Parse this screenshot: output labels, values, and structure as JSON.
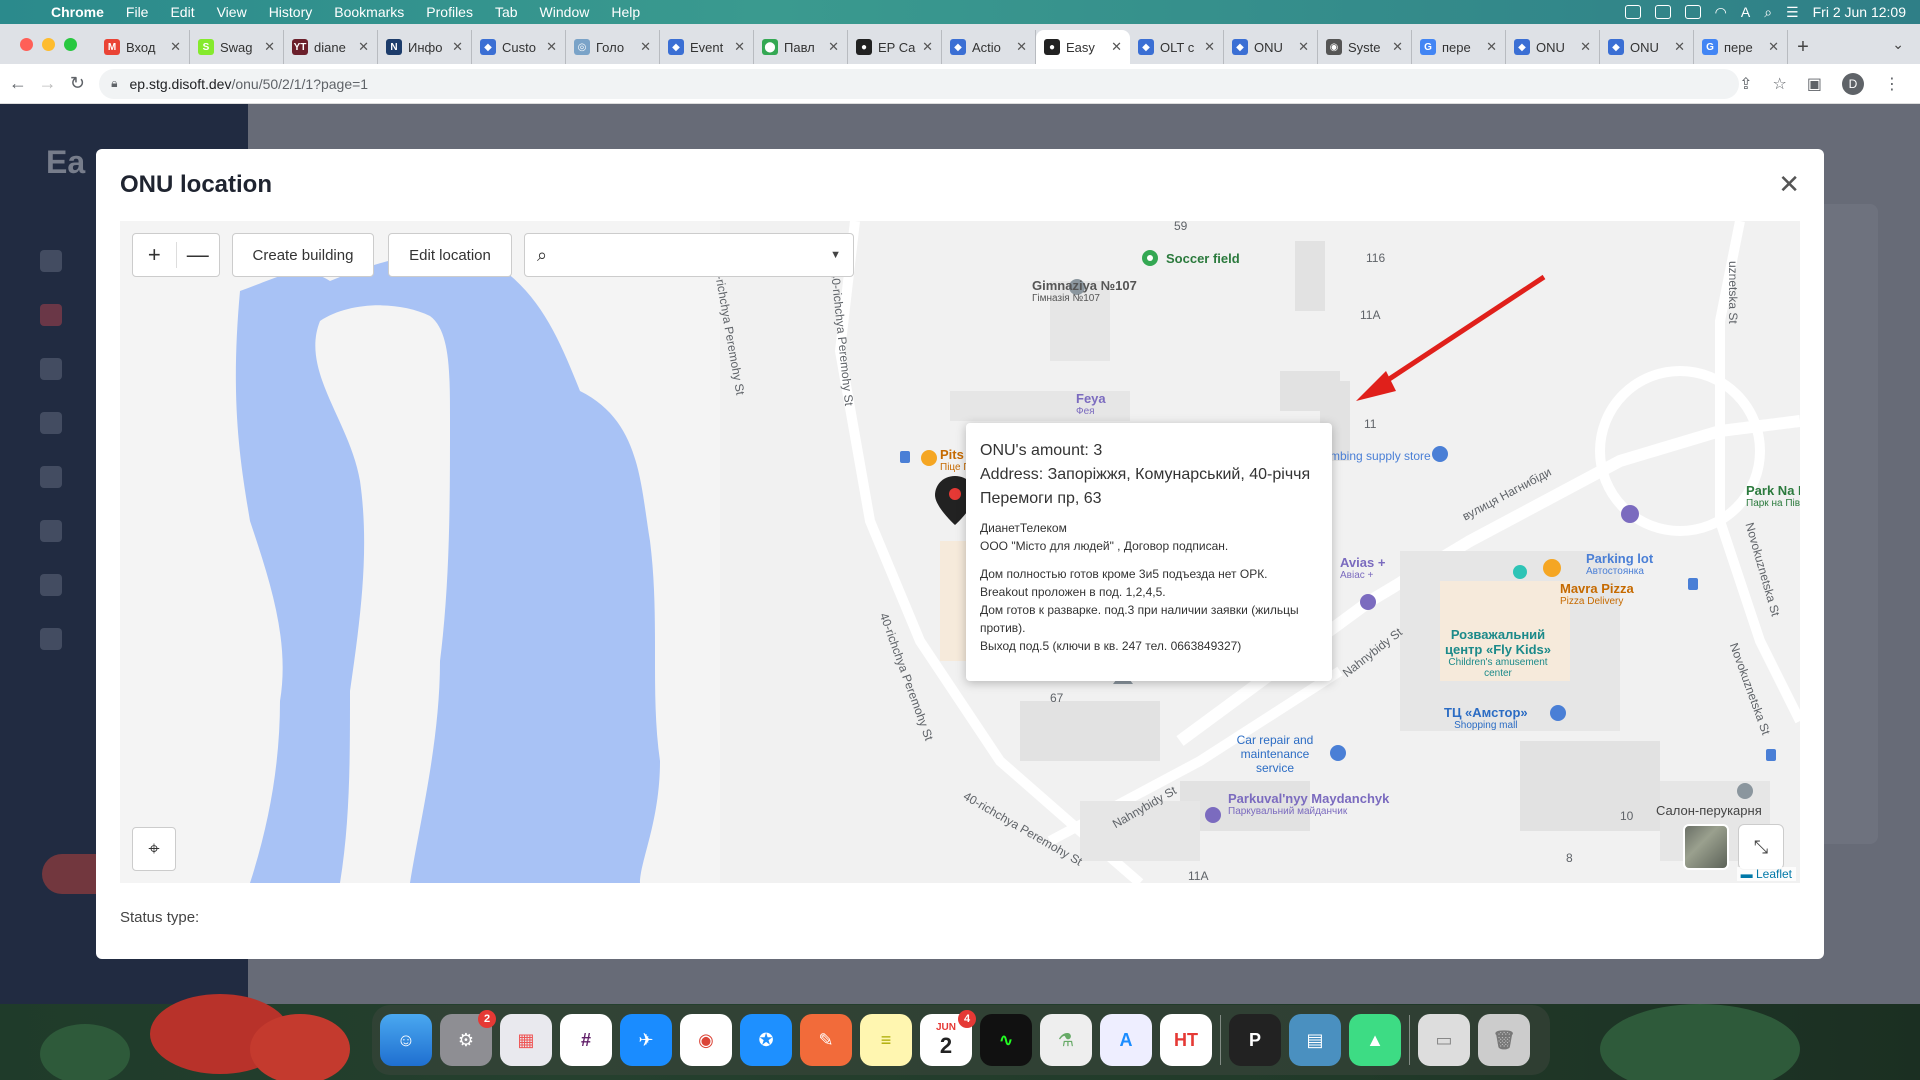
{
  "menubar": {
    "app": "Chrome",
    "items": [
      "File",
      "Edit",
      "View",
      "History",
      "Bookmarks",
      "Profiles",
      "Tab",
      "Window",
      "Help"
    ],
    "clock": "Fri 2 Jun  12:09"
  },
  "tabs": [
    {
      "label": "Вход",
      "color": "#ea4335",
      "glyph": "M"
    },
    {
      "label": "Swag",
      "color": "#85ea2d",
      "glyph": "S"
    },
    {
      "label": "diane",
      "color": "#6b1f2b",
      "glyph": "YT"
    },
    {
      "label": "Инфо",
      "color": "#1d3c6b",
      "glyph": "N"
    },
    {
      "label": "Custo",
      "color": "#3b6fd4",
      "glyph": "◆"
    },
    {
      "label": "Голо",
      "color": "#7aa3c8",
      "glyph": "◎"
    },
    {
      "label": "Event",
      "color": "#3b6fd4",
      "glyph": "◆"
    },
    {
      "label": "Павл",
      "color": "#34a853",
      "glyph": "⬤"
    },
    {
      "label": "EP Ca",
      "color": "#222222",
      "glyph": "●"
    },
    {
      "label": "Actio",
      "color": "#3b6fd4",
      "glyph": "◆"
    },
    {
      "label": "Easy",
      "color": "#222222",
      "glyph": "●",
      "active": true
    },
    {
      "label": "OLT c",
      "color": "#3b6fd4",
      "glyph": "◆"
    },
    {
      "label": "ONU",
      "color": "#3b6fd4",
      "glyph": "◆"
    },
    {
      "label": "Syste",
      "color": "#555555",
      "glyph": "◉"
    },
    {
      "label": "пере",
      "color": "#4285f4",
      "glyph": "G"
    },
    {
      "label": "ONU",
      "color": "#3b6fd4",
      "glyph": "◆"
    },
    {
      "label": "ONU",
      "color": "#3b6fd4",
      "glyph": "◆"
    },
    {
      "label": "пере",
      "color": "#4285f4",
      "glyph": "G"
    }
  ],
  "address": {
    "host": "ep.stg.disoft.dev",
    "path": "/onu/50/2/1/1?page=1"
  },
  "modal": {
    "title": "ONU location",
    "close": "✕",
    "status_label": "Status type:"
  },
  "map": {
    "zoom_in": "+",
    "zoom_out": "—",
    "create_building": "Create building",
    "edit_location": "Edit location",
    "search_value": "",
    "attribution": "Leaflet",
    "labels": {
      "gym": "Gimnaziya №107",
      "gym_sub": "Гімназія №107",
      "soccer": "Soccer field",
      "feya": "Feya",
      "feya_sub": "Фея",
      "avias": "Avias +",
      "avias_sub": "Авіас +",
      "parking": "Parking lot",
      "parking_sub": "Автостоянка",
      "mavra": "Mavra Pizza",
      "mavra_sub": "Pizza Delivery",
      "flykids": "Розважальний центр «Fly Kids»",
      "flykids_sub": "Children's amusement center",
      "amstor": "ТЦ «Амстор»",
      "amstor_sub": "Shopping mall",
      "carrepair": "Car repair and maintenance service",
      "parkuval": "Parkuval'nyy Maydanchyk",
      "parkuval_sub": "Паркувальний майданчик",
      "salon": "Салон-перукарня",
      "park": "Park Na Pivdenn",
      "park_sub": "Парк на Півден",
      "plumbing": "mbing supply store",
      "street1": "40-richchya Peremohy St",
      "street2": "40-richchya Peremohy St",
      "street3": "40-richchya Peremohy St",
      "street4": "Nahnybidy St",
      "street5": "Nahnybidy St",
      "street6": "вулиця Нагнибіди",
      "street7": "Novokuznetska St",
      "street8": "Novokuznetska St",
      "street9": "uznetska St",
      "n116": "116",
      "n11a": "11A",
      "n11": "11",
      "n67": "67",
      "n10": "10",
      "n8": "8",
      "n11a2": "11A",
      "n59": "59",
      "pits": "Pits",
      "pits_sub": "Піце Пізз"
    }
  },
  "popup": {
    "amount": "ONU's amount: 3",
    "address": "Address: Запоріжжя, Комунарський, 40-річчя Перемоги пр, 63",
    "provider": "ДианетТелеком",
    "company": "ООО \"Місто для людей\" , Договор подписан.",
    "note1": "Дом полностью готов кроме 3и5 подъезда нет ОРК.",
    "note2": "Breakout проложен в под. 1,2,4,5.",
    "note3": "Дом готов к разварке. под.3 при наличии заявки (жильцы против).",
    "note4": "Выход под.5 (ключи в кв. 247 тел. 0663849327)"
  },
  "dock": {
    "settings_badge": "2",
    "calendar_month": "JUN",
    "calendar_day": "2",
    "calendar_badge": "4"
  }
}
